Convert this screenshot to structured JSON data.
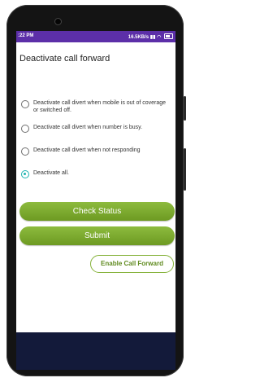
{
  "status_bar": {
    "time": ":22 PM",
    "right_text": "16.5KB/s",
    "accent_color": "#5c2fa8"
  },
  "page": {
    "title": "Deactivate call forward"
  },
  "options": [
    {
      "label": "Deactivate call divert when mobile is out of coverage or switched off.",
      "selected": false
    },
    {
      "label": "Deactivate call divert when number is busy.",
      "selected": false
    },
    {
      "label": "Deactivate call divert when not responding",
      "selected": false
    },
    {
      "label": "Deactivate all.",
      "selected": true
    }
  ],
  "buttons": {
    "check_status": "Check Status",
    "submit": "Submit",
    "enable_call_forward": "Enable Call Forward"
  },
  "colors": {
    "button_green": "#7aa82e",
    "radio_selected": "#1bb3b0",
    "nav_bar": "#131a3a"
  }
}
